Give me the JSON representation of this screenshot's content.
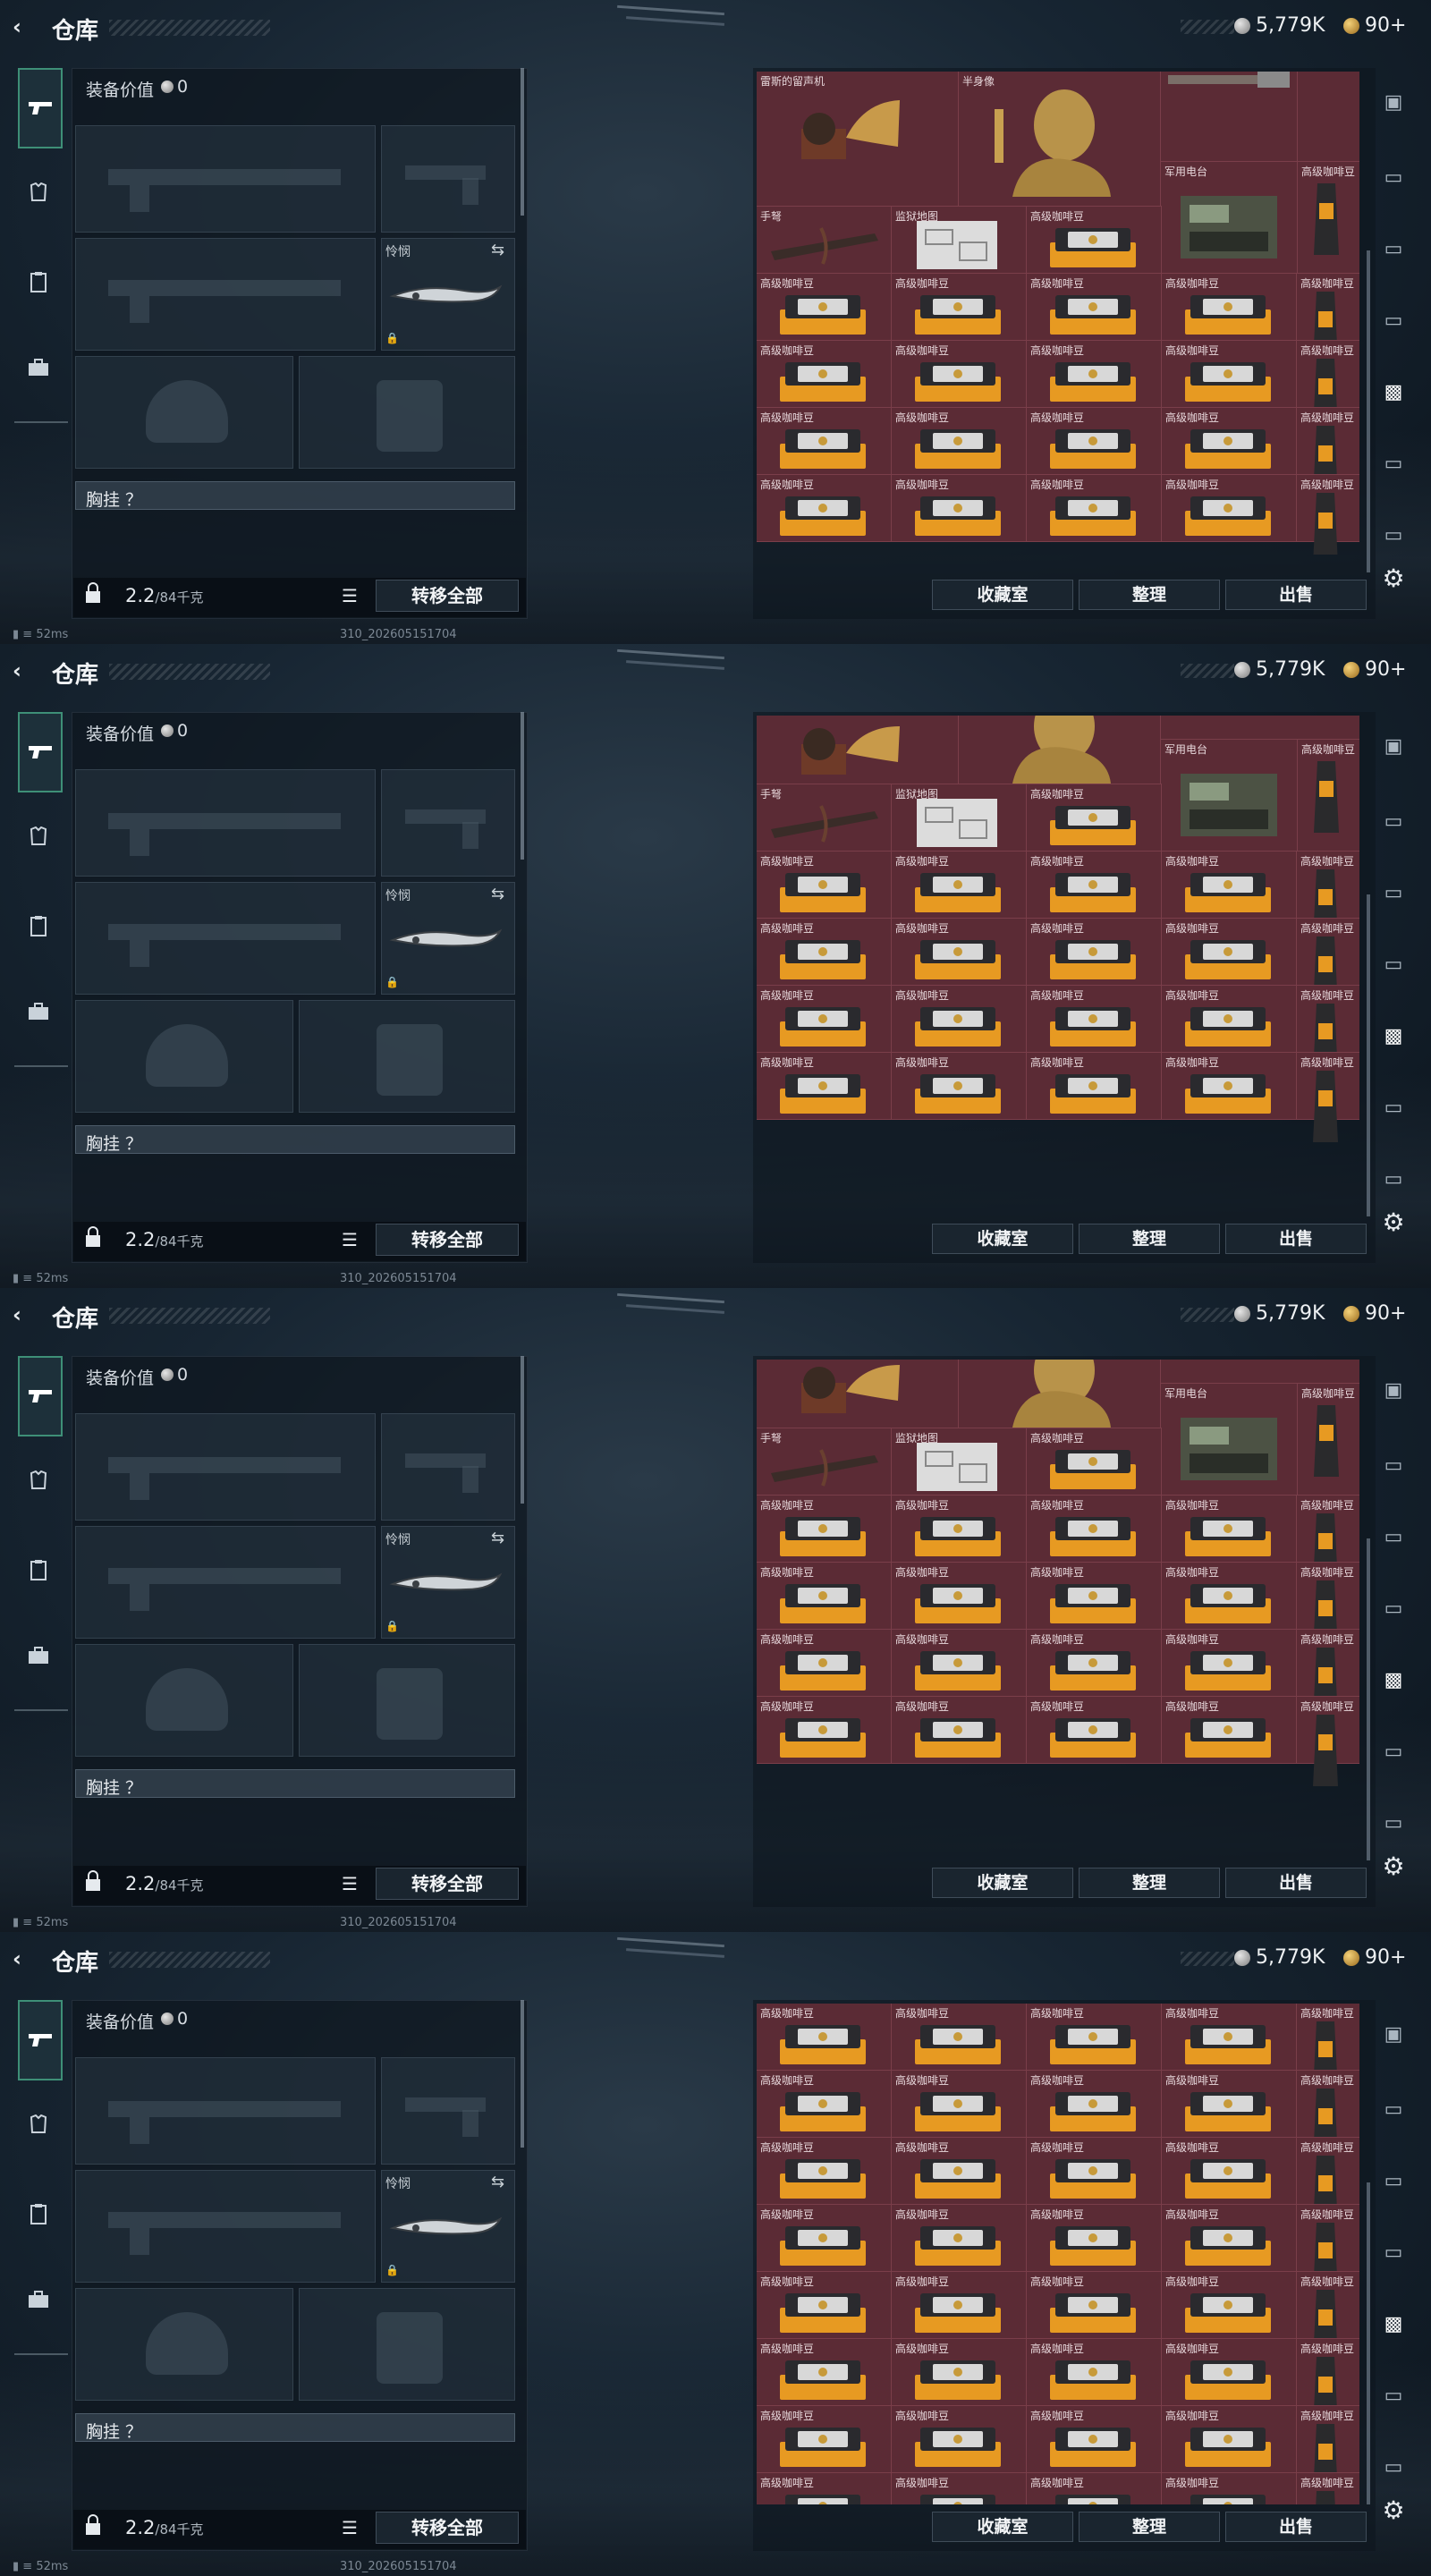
{
  "header": {
    "title": "仓库",
    "currency_silver": "5,779K",
    "currency_gold": "90+"
  },
  "equipment": {
    "value_label": "装备价值",
    "value": "0",
    "melee_label": "怜悯",
    "vest_label": "胸挂 ？",
    "weight_value": "2.2",
    "weight_max": "/84千克",
    "transfer_all": "转移全部"
  },
  "storage": {
    "items": {
      "gramophone": "雷斯的留声机",
      "bust": "半身像",
      "crossbow": "手弩",
      "map": "监狱地图",
      "radio": "军用电台",
      "coffee_box": "高级咖啡豆",
      "coffee_bag": "高级咖啡豆"
    },
    "buttons": {
      "collection": "收藏室",
      "organize": "整理",
      "sell": "出售"
    }
  },
  "status": {
    "ping": "52ms",
    "build": "310_202605151704"
  },
  "colors": {
    "accent": "#3e8f77",
    "cell": "#5b2b35",
    "cell_border": "#7a3e4a",
    "bean_orange": "#e79a22"
  }
}
